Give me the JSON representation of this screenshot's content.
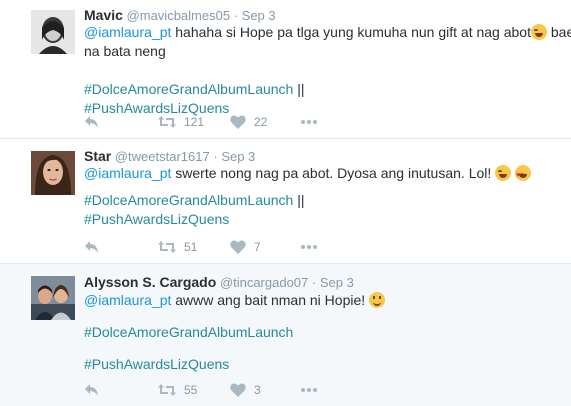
{
  "tweets": [
    {
      "name": "Mavic",
      "handle": "@mavicbalmes05",
      "dot": "·",
      "date": "Sep 3",
      "mention": "@iamlaura_pt",
      "text_a": " hahaha si Hope pa tlga yung kumuha nun gift at nag abot",
      "text_b": " baet",
      "text_c": "na bata neng",
      "hashtag_1": "#DolceAmoreGrandAlbumLaunch",
      "hashtag_1_suffix": " ||",
      "hashtag_2": "#PushAwardsLizQuens",
      "retweets": "121",
      "likes": "22",
      "emoji": [
        "laugh"
      ]
    },
    {
      "name": "Star",
      "handle": "@tweetstar1617",
      "dot": "·",
      "date": "Sep 3",
      "mention": "@iamlaura_pt",
      "text_a": " swerte nong nag pa abot. Dyosa ang inutusan. Lol!",
      "hashtag_1": "#DolceAmoreGrandAlbumLaunch",
      "hashtag_1_suffix": " ||",
      "hashtag_2": "#PushAwardsLizQuens",
      "retweets": "51",
      "likes": "7",
      "emoji": [
        "laugh",
        "heart-eyes"
      ]
    },
    {
      "name": "Alysson S. Cargado",
      "handle": "@tincargado07",
      "dot": "·",
      "date": "Sep 3",
      "mention": "@iamlaura_pt",
      "text_a": " awww ang bait nman ni Hopie!",
      "hashtag_1": "#DolceAmoreGrandAlbumLaunch",
      "hashtag_2": "#PushAwardsLizQuens",
      "retweets": "55",
      "likes": "3",
      "emoji": [
        "smile"
      ]
    }
  ],
  "icons": {
    "reply": "reply-icon",
    "retweet": "retweet-icon",
    "like": "heart-icon",
    "more": "more-icon"
  },
  "colors": {
    "link": "#1b95e0",
    "hashtag": "#268a9b",
    "muted": "#8899a6",
    "text": "#292f33",
    "alt_background": "#f5f8fa"
  }
}
